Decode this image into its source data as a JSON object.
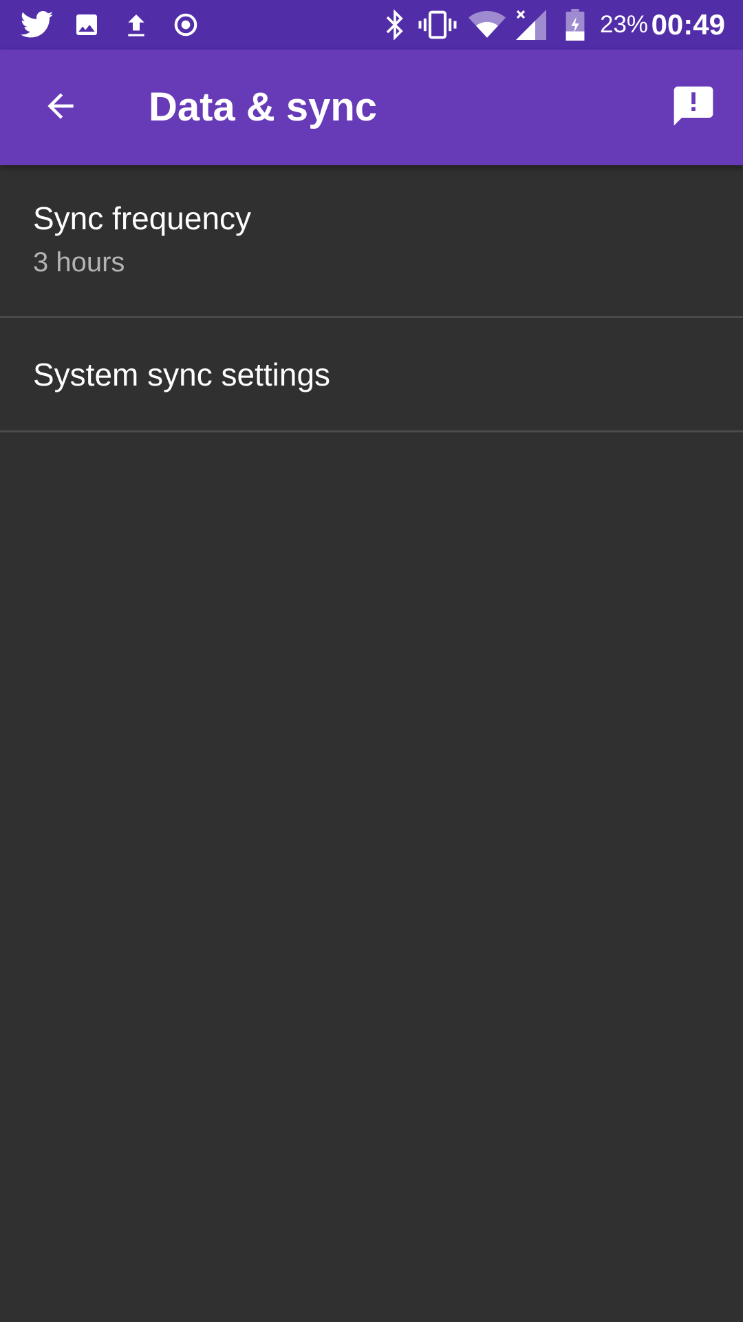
{
  "status_bar": {
    "left_icons": [
      "twitter-icon",
      "image-icon",
      "upload-icon",
      "record-icon"
    ],
    "right_icons": [
      "bluetooth-icon",
      "vibrate-icon",
      "wifi-icon",
      "cell-signal-icon",
      "battery-charging-icon"
    ],
    "battery_percent": "23%",
    "time": "00:49"
  },
  "app_bar": {
    "title": "Data & sync",
    "back_icon": "arrow-back-icon",
    "feedback_icon": "feedback-icon",
    "color": "#673ab7",
    "status_color": "#512da8"
  },
  "settings": {
    "items": [
      {
        "title": "Sync frequency",
        "summary": "3 hours"
      },
      {
        "title": "System sync settings"
      }
    ]
  },
  "colors": {
    "background": "#303030",
    "divider": "#4a4a4a",
    "summary_text": "#b3b3b3"
  }
}
